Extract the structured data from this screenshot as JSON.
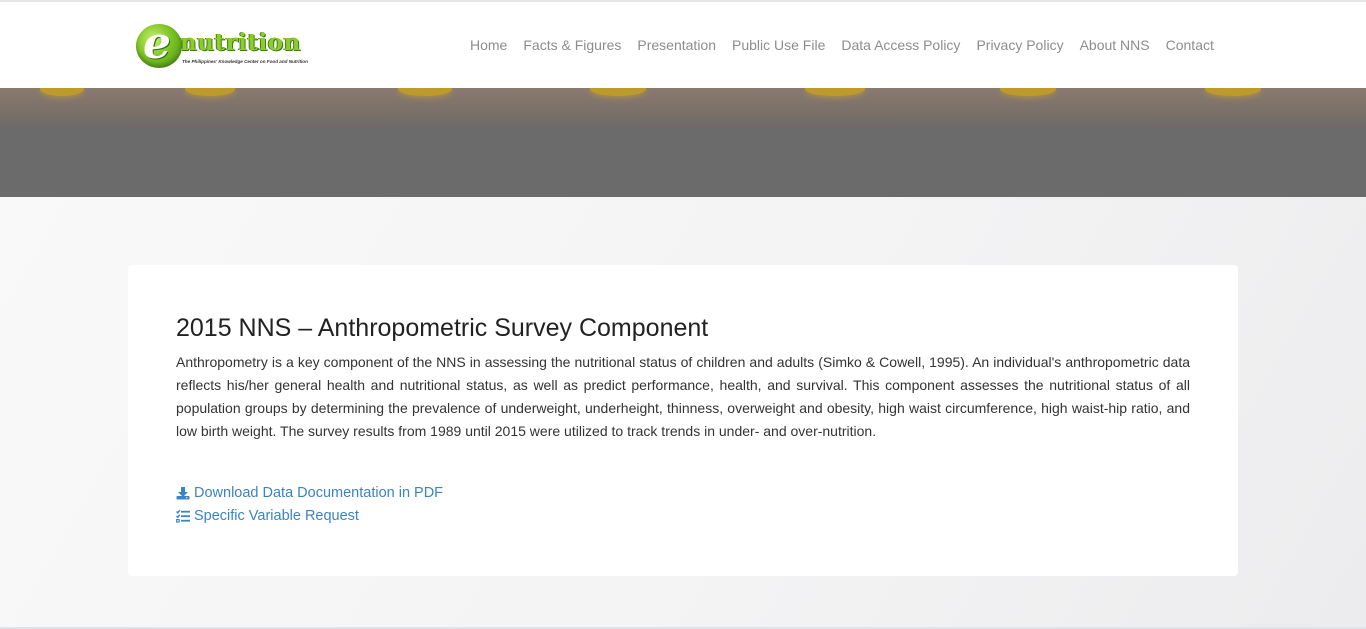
{
  "brand": {
    "logo_letter": "e",
    "logo_word": "nutrition",
    "tagline": "The Philippines' Knowledge Center on Food and Nutrition"
  },
  "nav": {
    "items": [
      {
        "label": "Home"
      },
      {
        "label": "Facts & Figures"
      },
      {
        "label": "Presentation"
      },
      {
        "label": "Public Use File"
      },
      {
        "label": "Data Access Policy"
      },
      {
        "label": "Privacy Policy"
      },
      {
        "label": "About NNS"
      },
      {
        "label": "Contact"
      }
    ]
  },
  "main": {
    "title": "2015 NNS – Anthropometric Survey Component",
    "description": "Anthropometry is a key component of the NNS in assessing the nutritional status of children and adults (Simko & Cowell, 1995). An individual's anthropometric data reflects his/her general health and nutritional status, as well as predict performance, health, and survival. This component assesses the nutritional status of all population groups by determining the prevalence of underweight, underheight, thinness, overweight and obesity, high waist circumference, high waist-hip ratio, and low birth weight. The survey results from 1989 until 2015 were utilized to track trends in under- and over-nutrition.",
    "links": {
      "download_label": "Download Data Documentation in PDF",
      "download_icon": "download-icon",
      "request_label": "Specific Variable Request",
      "request_icon": "list-check-icon"
    }
  },
  "colors": {
    "link": "#3a84c5",
    "nav_text": "#8d8d8d",
    "hero": "#6b6b6b",
    "logo_green": "#8ccd2b"
  }
}
